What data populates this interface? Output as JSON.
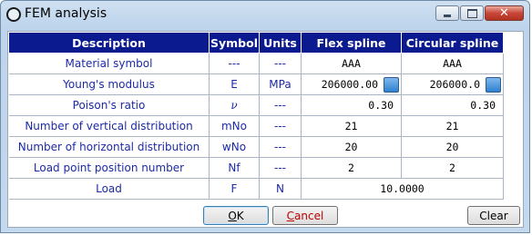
{
  "window": {
    "title": "FEM analysis"
  },
  "table": {
    "headers": [
      "Description",
      "Symbol",
      "Units",
      "Flex spline",
      "Circular spline"
    ],
    "rows": [
      {
        "description": "Material symbol",
        "symbol": "---",
        "units": "---",
        "flex": "AAA",
        "circular": "AAA"
      },
      {
        "description": "Young's modulus",
        "symbol": "E",
        "units": "MPa",
        "flex": "206000.00",
        "circular": "206000.0"
      },
      {
        "description": "Poison's ratio",
        "symbol": "ν",
        "units": "---",
        "flex": "0.30",
        "circular": "0.30"
      },
      {
        "description": "Number of vertical distribution",
        "symbol": "mNo",
        "units": "---",
        "flex": "21",
        "circular": "21"
      },
      {
        "description": "Number of horizontal distribution",
        "symbol": "wNo",
        "units": "---",
        "flex": "20",
        "circular": "20"
      },
      {
        "description": "Load point position number",
        "symbol": "Nf",
        "units": "---",
        "flex": "2",
        "circular": "2"
      },
      {
        "description": "Load",
        "symbol": "F",
        "units": "N",
        "value": "10.0000"
      }
    ]
  },
  "buttons": {
    "ok": {
      "accel": "O",
      "rest": "K"
    },
    "cancel": {
      "accel": "C",
      "rest": "ancel"
    },
    "clear": "Clear"
  },
  "colors": {
    "header_bg": "#0b1b8f",
    "label_text": "#1d2aa6",
    "title_bar": "#bdd4ec",
    "cancel_text": "#c00000"
  }
}
